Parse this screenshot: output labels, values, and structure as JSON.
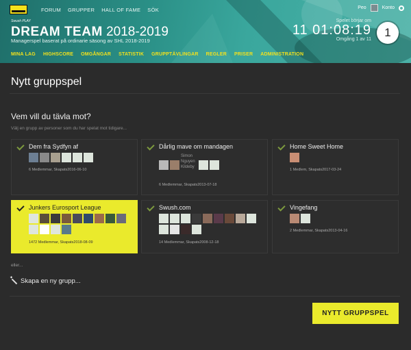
{
  "topnav": {
    "items": [
      "FORUM",
      "GRUPPER",
      "HALL OF FAME",
      "SÖK"
    ],
    "user_name": "Peo",
    "account_label": "Konto"
  },
  "header": {
    "brand_small": "Swush PLAY",
    "title_bold": "DREAM TEAM",
    "title_season": "2018-2019",
    "subtitle": "Managerspel baserat på ordinarie säsong av SHL 2018-2019",
    "countdown_label": "Spelet börjar om",
    "countdown_time": "11 01:08:19",
    "round_label": "Omgång 1 av 11",
    "round_number": "1"
  },
  "mainnav": {
    "items": [
      "MINA LAG",
      "HIGHSCORE",
      "OMGÅNGAR",
      "STATISTIK",
      "GRUPPTÄVLINGAR",
      "REGLER",
      "PRISER",
      "ADMINISTRATION"
    ],
    "color": "#f3e11c"
  },
  "page": {
    "title": "Nytt gruppspel",
    "section_title": "Vem vill du tävla mot?",
    "hint": "Välj en grupp av personer som du har spelat mot tidigare...",
    "eller": "eller...",
    "create_label": "Skapa en ny grupp...",
    "button_label": "NYTT GRUPPSPEL"
  },
  "groups": [
    {
      "name": "Dem fra Sydfyn af",
      "meta": "6 Medlemmar, Skapats2016-06-10",
      "selected": false
    },
    {
      "name": "Dårlig mave om mandagen",
      "meta": "6 Medlemmar, Skapats2013-07-18",
      "selected": false,
      "broken_text": "Simon Nguyen Kildeby"
    },
    {
      "name": "Home Sweet Home",
      "meta": "1 Medlem, Skapats2017-03-24",
      "selected": false
    },
    {
      "name": "Junkers Eurosport League",
      "meta": "1472 Medlemmar, Skapats2018-08-09",
      "selected": true
    },
    {
      "name": "Swush.com",
      "meta": "14 Medlemmar, Skapats2008-12-18",
      "selected": false
    },
    {
      "name": "Vingefang",
      "meta": "2 Medlemmar, Skapats2013-04-16",
      "selected": false
    }
  ],
  "colors": {
    "accent": "#eaea2c",
    "check": "#7d9a3e",
    "background": "#2b2b2b"
  }
}
